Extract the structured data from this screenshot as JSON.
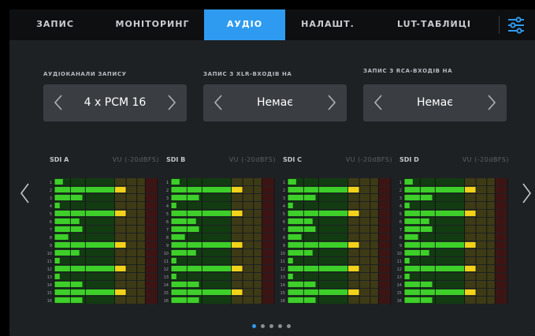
{
  "tabs": [
    {
      "label": "ЗАПИС",
      "active": false
    },
    {
      "label": "МОНІТОРИНГ",
      "active": false
    },
    {
      "label": "АУДІО",
      "active": true
    },
    {
      "label": "НАЛАШТ.",
      "active": false
    },
    {
      "label": "LUT-ТАБЛИЦІ",
      "active": false
    }
  ],
  "settings_icon": "sliders-icon",
  "selectors": [
    {
      "label": "АУДІОКАНАЛИ ЗАПИСУ",
      "value": "4 x PCM 16"
    },
    {
      "label": "ЗАПИС З XLR-ВХОДІВ НА",
      "value": "Немає"
    },
    {
      "label": "ЗАПИС З RCA-ВХОДІВ НА",
      "value": "Немає"
    }
  ],
  "meters": [
    {
      "title": "SDI A",
      "scale": "VU (-20dBFS)"
    },
    {
      "title": "SDI B",
      "scale": "VU (-20dBFS)"
    },
    {
      "title": "SDI C",
      "scale": "VU (-20dBFS)"
    },
    {
      "title": "SDI D",
      "scale": "VU (-20dBFS)"
    }
  ],
  "channel_numbers": [
    "1",
    "2",
    "3",
    "4",
    "5",
    "6",
    "7",
    "8",
    "9",
    "10",
    "11",
    "12",
    "13",
    "14",
    "15",
    "16"
  ],
  "scale_ticks": [
    "-45",
    "-30",
    "-20",
    "-10",
    "-6",
    "-3",
    "0",
    "+3"
  ],
  "channel_levels_db": [
    -37,
    -6,
    -22,
    -40,
    -6,
    -24,
    -22,
    -32,
    -6,
    -24,
    -40,
    -6,
    -40,
    -22,
    -6,
    -22
  ],
  "colors": {
    "accent": "#2f9bf0",
    "meter_green": "#3ecf2a",
    "meter_yellow": "#f2d21a",
    "meter_red": "#a31d1d"
  },
  "pager": {
    "pages": 5,
    "current": 1
  },
  "nav": {
    "left": "chevron-left-icon",
    "right": "chevron-right-icon"
  }
}
